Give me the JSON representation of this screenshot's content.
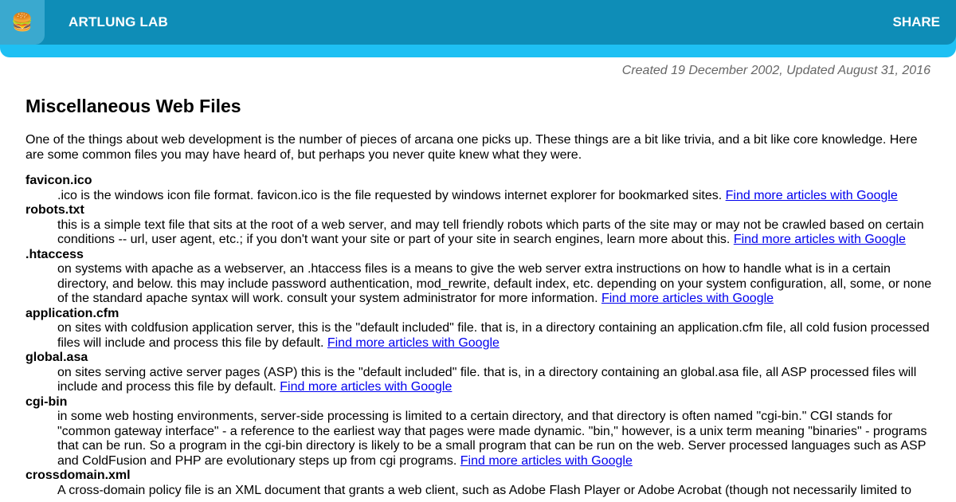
{
  "header": {
    "logo_icon": "hamburger-icon",
    "logo_glyph": "🍔",
    "site_title": "ARTLUNG LAB",
    "share_label": "SHARE",
    "colors": {
      "bar": "#0e8db7",
      "accent_strip": "#1ec0f3",
      "logo_box": "#3aa9cf"
    }
  },
  "page": {
    "dates": "Created 19 December 2002, Updated August 31, 2016",
    "title": "Miscellaneous Web Files",
    "intro": "One of the things about web development is the number of pieces of arcana one picks up. These things are a bit like trivia, and a bit like core knowledge. Here are some common files you may have heard of, but perhaps you never quite knew what they were."
  },
  "link_label": "Find more articles with Google",
  "entries": [
    {
      "term": "favicon.ico",
      "desc": ".ico is the windows icon file format. favicon.ico is the file requested by windows internet explorer for bookmarked sites."
    },
    {
      "term": "robots.txt",
      "desc": "this is a simple text file that sits at the root of a web server, and may tell friendly robots which parts of the site may or may not be crawled based on certain conditions -- url, user agent, etc.; if you don't want your site or part of your site in search engines, learn more about this."
    },
    {
      "term": ".htaccess",
      "desc": "on systems with apache as a webserver, an .htaccess files is a means to give the web server extra instructions on how to handle what is in a certain directory, and below. this may include password authentication, mod_rewrite, default index, etc. depending on your system configuration, all, some, or none of the standard apache syntax will work. consult your system administrator for more information."
    },
    {
      "term": "application.cfm",
      "desc": "on sites with coldfusion application server, this is the \"default included\" file. that is, in a directory containing an application.cfm file, all cold fusion processed files will include and process this file by default."
    },
    {
      "term": "global.asa",
      "desc": "on sites serving active server pages (ASP) this is the \"default included\" file. that is, in a directory containing an global.asa file, all ASP processed files will include and process this file by default."
    },
    {
      "term": "cgi-bin",
      "desc": "in some web hosting environments, server-side processing is limited to a certain directory, and that directory is often named \"cgi-bin.\" CGI stands for \"common gateway interface\" - a reference to the earliest way that pages were made dynamic. \"bin,\" however, is a unix term meaning \"binaries\" - programs that can be run. So a program in the cgi-bin directory is likely to be a small program that can be run on the web. Server processed languages such as ASP and ColdFusion and PHP are evolutionary steps up from cgi programs."
    },
    {
      "term": "crossdomain.xml",
      "desc": "A cross-domain policy file is an XML document that grants a web client, such as Adobe Flash Player or Adobe Acrobat (though not necessarily limited to"
    }
  ]
}
